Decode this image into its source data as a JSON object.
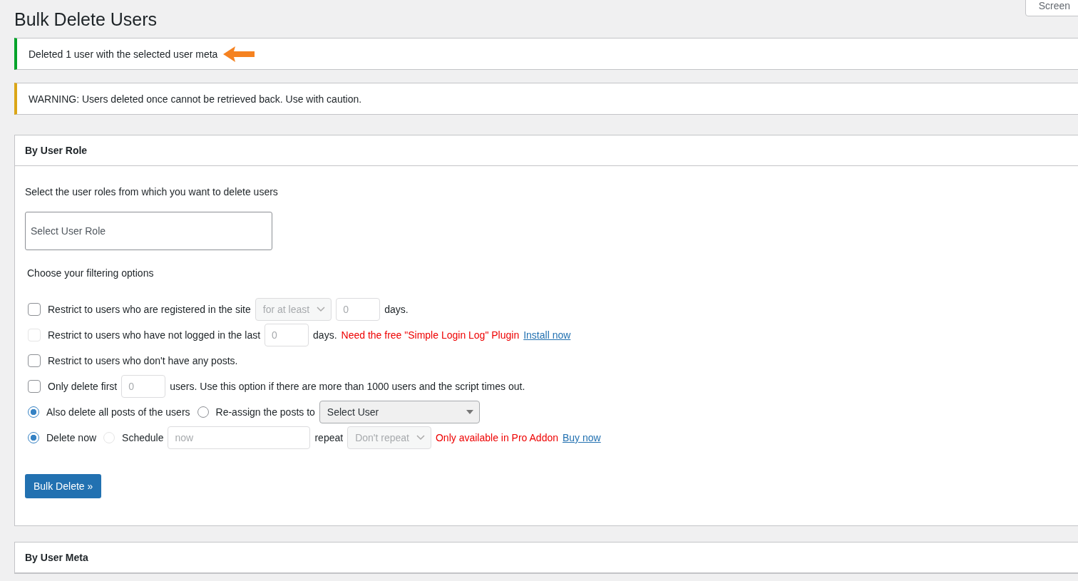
{
  "page_title": "Bulk Delete Users",
  "screen_button": "Screen",
  "notices": [
    {
      "kind": "success",
      "text": "Deleted 1 user with the selected user meta",
      "arrow": true
    },
    {
      "kind": "warning",
      "text": "WARNING: Users deleted once cannot be retrieved back. Use with caution.",
      "arrow": false
    }
  ],
  "panels": [
    {
      "title": "By User Role",
      "intro": "Select the user roles from which you want to delete users",
      "role_select": {
        "placeholder": "Select User Role"
      },
      "filter_heading": "Choose your filtering options",
      "rows": [
        {
          "parts": [
            {
              "kind": "checkbox",
              "checked": false,
              "disabled": false
            },
            {
              "kind": "text",
              "text": "Restrict to users who are registered in the site"
            },
            {
              "kind": "select",
              "text": "for at least",
              "disabled": true
            },
            {
              "kind": "input",
              "placeholder": "0"
            },
            {
              "kind": "text",
              "text": "days."
            }
          ]
        },
        {
          "parts": [
            {
              "kind": "checkbox",
              "checked": false,
              "disabled": true
            },
            {
              "kind": "text",
              "text": "Restrict to users who have not logged in the last"
            },
            {
              "kind": "input",
              "placeholder": "0"
            },
            {
              "kind": "text",
              "text": "days."
            },
            {
              "kind": "note",
              "text": "Need the free \"Simple Login Log\" Plugin"
            },
            {
              "kind": "link",
              "text": "Install now"
            }
          ]
        },
        {
          "parts": [
            {
              "kind": "checkbox",
              "checked": false,
              "disabled": false
            },
            {
              "kind": "text",
              "text": "Restrict to users who don't have any posts."
            }
          ]
        },
        {
          "parts": [
            {
              "kind": "checkbox",
              "checked": false,
              "disabled": false
            },
            {
              "kind": "text",
              "text": "Only delete first"
            },
            {
              "kind": "input",
              "placeholder": "0"
            },
            {
              "kind": "text",
              "text": "users. Use this option if there are more than 1000 users and the script times out."
            }
          ]
        },
        {
          "parts": [
            {
              "kind": "radio",
              "selected": true,
              "disabled": false
            },
            {
              "kind": "text",
              "text": "Also delete all posts of the users"
            },
            {
              "kind": "radio",
              "selected": false,
              "disabled": false
            },
            {
              "kind": "text",
              "text": "Re-assign the posts to"
            },
            {
              "kind": "select",
              "text": "Select User",
              "disabled": false
            }
          ]
        },
        {
          "parts": [
            {
              "kind": "radio",
              "selected": true,
              "disabled": false
            },
            {
              "kind": "text",
              "text": "Delete now"
            },
            {
              "kind": "radio",
              "selected": false,
              "disabled": true
            },
            {
              "kind": "text",
              "text": "Schedule"
            },
            {
              "kind": "wide_input",
              "placeholder": "now"
            },
            {
              "kind": "text",
              "text": "repeat"
            },
            {
              "kind": "select",
              "text": "Don't repeat",
              "disabled": true
            },
            {
              "kind": "note",
              "text": "Only available in Pro Addon"
            },
            {
              "kind": "link",
              "text": "Buy now"
            }
          ]
        }
      ],
      "button": "Bulk Delete »"
    },
    {
      "title": "By User Meta"
    }
  ]
}
